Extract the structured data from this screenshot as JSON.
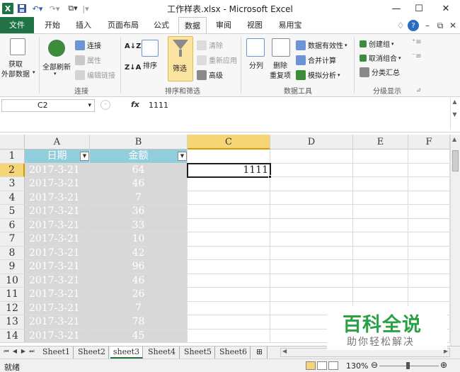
{
  "window": {
    "title": "工作样表.xlsx - Microsoft Excel",
    "logo": "X",
    "quick_access": [
      "save-icon",
      "undo-icon",
      "redo-icon",
      "format-painter-icon"
    ],
    "controls": {
      "minimize": "—",
      "maximize": "☐",
      "close": "✕"
    }
  },
  "tabs": [
    {
      "label": "文件"
    },
    {
      "label": "开始"
    },
    {
      "label": "插入"
    },
    {
      "label": "页面布局"
    },
    {
      "label": "公式"
    },
    {
      "label": "数据"
    },
    {
      "label": "审阅"
    },
    {
      "label": "视图"
    },
    {
      "label": "易用宝"
    }
  ],
  "active_tab": "数据",
  "ribbon": {
    "get_external": {
      "line1": "获取",
      "line2": "外部数据"
    },
    "refresh_all": "全部刷新",
    "connections": "连接",
    "properties": "属性",
    "edit_links": "编辑链接",
    "group_connections": "连接",
    "sort_az": "A↓Z",
    "sort_za": "Z↓A",
    "sort": "排序",
    "filter": "筛选",
    "clear": "清除",
    "reapply": "重新应用",
    "advanced": "高级",
    "group_sort_filter": "排序和筛选",
    "text_to_columns": "分列",
    "remove_duplicates_line1": "删除",
    "remove_duplicates_line2": "重复项",
    "data_validation": "数据有效性",
    "consolidate": "合并计算",
    "what_if": "模拟分析",
    "group_data_tools": "数据工具",
    "group": "创建组",
    "ungroup": "取消组合",
    "subtotal": "分类汇总",
    "group_outline": "分级显示"
  },
  "formula_bar": {
    "name_box": "C2",
    "fx": "fx",
    "value": "1111"
  },
  "columns": [
    "A",
    "B",
    "C",
    "D",
    "E",
    "F"
  ],
  "header_row": {
    "a": "日期",
    "b": "金额"
  },
  "rows": [
    {
      "num": "1"
    },
    {
      "num": "2",
      "date": "2017-3-21",
      "amount": "64"
    },
    {
      "num": "3",
      "date": "2017-3-21",
      "amount": "46"
    },
    {
      "num": "4",
      "date": "2017-3-21",
      "amount": "7"
    },
    {
      "num": "5",
      "date": "2017-3-21",
      "amount": "36"
    },
    {
      "num": "6",
      "date": "2017-3-21",
      "amount": "33"
    },
    {
      "num": "7",
      "date": "2017-3-21",
      "amount": "10"
    },
    {
      "num": "8",
      "date": "2017-3-21",
      "amount": "42"
    },
    {
      "num": "9",
      "date": "2017-3-21",
      "amount": "96"
    },
    {
      "num": "10",
      "date": "2017-3-21",
      "amount": "46"
    },
    {
      "num": "11",
      "date": "2017-3-21",
      "amount": "26"
    },
    {
      "num": "12",
      "date": "2017-3-21",
      "amount": "7"
    },
    {
      "num": "13",
      "date": "2017-3-21",
      "amount": "78"
    },
    {
      "num": "14",
      "date": "2017-3-21",
      "amount": "45"
    }
  ],
  "active_cell": {
    "ref": "C2",
    "value": "1111"
  },
  "sheets": [
    "Sheet1",
    "Sheet2",
    "sheet3",
    "Sheet4",
    "Sheet5",
    "Sheet6"
  ],
  "active_sheet": "sheet3",
  "status": {
    "text": "就绪",
    "zoom": "130%"
  },
  "watermark": {
    "title": "百科全说",
    "subtitle": "助你轻松解决"
  },
  "colors": {
    "accent": "#1f7244",
    "header_fill": "#92cddc",
    "grey_fill": "#d8d8d8",
    "selected_header": "#f5d576"
  }
}
